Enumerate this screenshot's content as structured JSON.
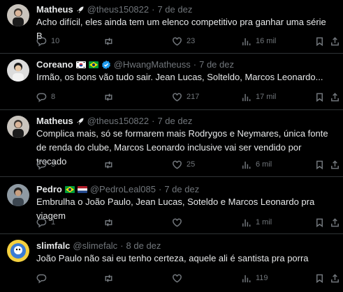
{
  "tweets": [
    {
      "name": "Matheus",
      "handle": "@theus150822",
      "date": "7 de dez",
      "text": "Acho difícil, eles ainda tem um elenco competitivo pra ganhar uma série B",
      "replies": "10",
      "retweets": "",
      "likes": "23",
      "views": "16 mil"
    },
    {
      "name": "Coreano",
      "handle": "@HwangMatheuss",
      "date": "7 de dez",
      "text": "Irmão, os bons vão tudo sair. Jean Lucas, Solteldo, Marcos Leonardo...",
      "replies": "8",
      "retweets": "",
      "likes": "217",
      "views": "17 mil"
    },
    {
      "name": "Matheus",
      "handle": "@theus150822",
      "date": "7 de dez",
      "text": "Complica mais, só se formarem mais Rodrygos e Neymares, única fonte de renda do clube, Marcos Leonardo inclusive vai ser vendido por trocado",
      "replies": "3",
      "retweets": "",
      "likes": "25",
      "views": "6 mil"
    },
    {
      "name": "Pedro",
      "handle": "@PedroLeal085",
      "date": "7 de dez",
      "text": "Embrulha o João Paulo, Jean Lucas, Soteldo e Marcos Leonardo pra viagem",
      "replies": "1",
      "retweets": "",
      "likes": "",
      "views": "1 mil"
    },
    {
      "name": "slimfalc",
      "handle": "@slimefalc",
      "date": "8 de dez",
      "text": "João Paulo não sai eu tenho certeza, aquele ali é santista pra porra",
      "replies": "",
      "retweets": "",
      "likes": "",
      "views": "119"
    }
  ],
  "separator": "·",
  "colors": {
    "background": "#000000",
    "text": "#e7e9ea",
    "muted": "#71767b",
    "divider": "#2f3336",
    "verified": "#1d9bf0"
  },
  "icons": [
    "reply-icon",
    "retweet-icon",
    "like-icon",
    "views-icon",
    "bookmark-icon",
    "share-icon",
    "verified-badge-icon",
    "rocket-icon",
    "korea-flag-icon",
    "brazil-flag-icon",
    "netherlands-flag-icon"
  ]
}
